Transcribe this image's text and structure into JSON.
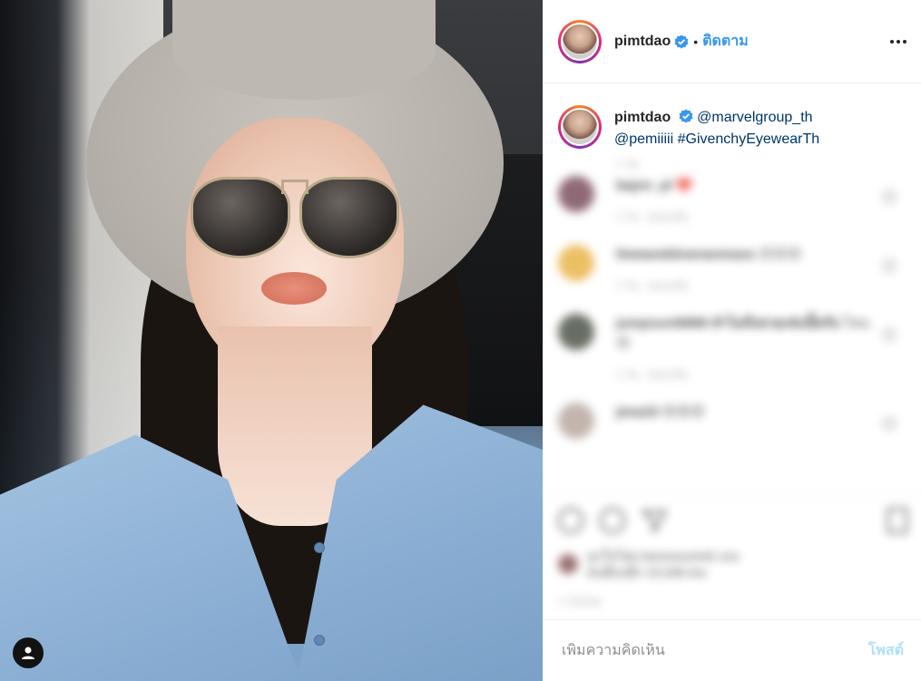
{
  "post": {
    "photo_alt_icon": "user-tag-icon"
  },
  "header": {
    "username": "pimtdao",
    "separator": "•",
    "follow_label": "ติดตาม",
    "verified_icon": "verified-badge-icon",
    "more_icon": "more-options-icon"
  },
  "caption": {
    "username": "pimtdao",
    "mention1": "@marvelgroup_th",
    "mention2": "@pemiiiii",
    "hashtag": "#GivenchyEyewearTh"
  },
  "comments": {
    "caption_time": "1 วัน",
    "items": [
      {
        "username": "bajon_pl",
        "text": "❤️",
        "time": "1 วัน",
        "reply_label": "ตอบกลับ",
        "avatar_color": "#7c5060"
      },
      {
        "username": "liwwanddownanmass",
        "text": "😊😊😊",
        "time": "1 วัน",
        "reply_label": "ตอบกลับ",
        "avatar_color": "#e8b54a"
      },
      {
        "username": "jumpsunt9888 ทำไมถึงสวยเช่นนี้ครับ",
        "text": "ไหน 😊",
        "time": "1 วัน",
        "reply_label": "ตอบกลับ",
        "avatar_color": "#4e5548"
      },
      {
        "username": "jima33",
        "text": "😍😍😍",
        "time": "1 วัน",
        "reply_label": "ตอบกลับ",
        "avatar_color": "#b9a8a0"
      }
    ]
  },
  "actions": {
    "likes_text": "ถูกใจโดย bonosxunmit และ",
    "likes_text2": "คนอื่นๆอีก 15,048 คน",
    "posted_time": "1 วันก่อน"
  },
  "add_comment": {
    "placeholder": "เพิ่มความคิดเห็น",
    "post_label": "โพสต์"
  },
  "colors": {
    "link": "#003569",
    "follow": "#3897f0",
    "post_disabled": "#b2dffc"
  }
}
